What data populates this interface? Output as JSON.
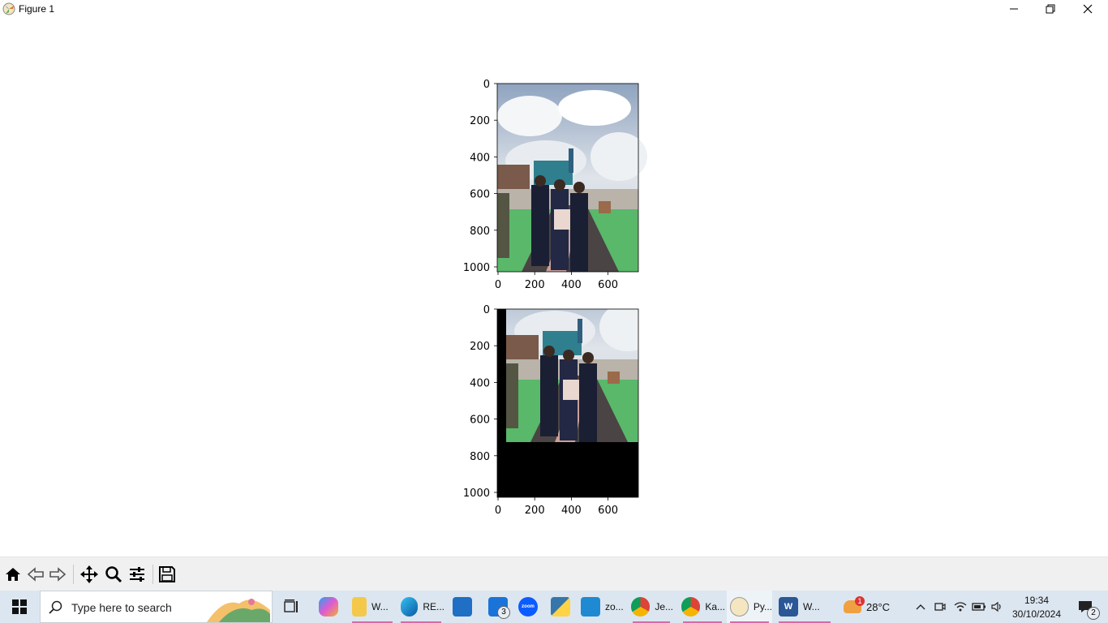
{
  "window": {
    "title": "Figure 1",
    "controls": {
      "minimize": "minimize",
      "maximize": "restore",
      "close": "close"
    }
  },
  "figure": {
    "subplots": [
      {
        "name": "original-image",
        "y_ticks": [
          "0",
          "200",
          "400",
          "600",
          "800",
          "1000"
        ],
        "x_ticks": [
          "0",
          "200",
          "400",
          "600"
        ]
      },
      {
        "name": "translated-image",
        "y_ticks": [
          "0",
          "200",
          "400",
          "600",
          "800",
          "1000"
        ],
        "x_ticks": [
          "0",
          "200",
          "400",
          "600"
        ]
      }
    ]
  },
  "toolbar": {
    "buttons": [
      "home-icon",
      "back-icon",
      "forward-icon",
      "pan-icon",
      "zoom-icon",
      "configure-subplots-icon",
      "save-icon"
    ]
  },
  "taskbar": {
    "search_placeholder": "Type here to search",
    "apps": [
      {
        "name": "task-view",
        "label": ""
      },
      {
        "name": "copilot",
        "label": ""
      },
      {
        "name": "file-explorer",
        "label": "W..."
      },
      {
        "name": "edge",
        "label": "RE..."
      },
      {
        "name": "store",
        "label": ""
      },
      {
        "name": "mail",
        "label": "",
        "badge": "3"
      },
      {
        "name": "zoom",
        "label": ""
      },
      {
        "name": "python-idle",
        "label": ""
      },
      {
        "name": "vscode",
        "label": "zo..."
      },
      {
        "name": "chrome-1",
        "label": "Je..."
      },
      {
        "name": "chrome-2",
        "label": "Ka..."
      },
      {
        "name": "pyfigure",
        "label": "Py..."
      },
      {
        "name": "word",
        "label": "W..."
      }
    ],
    "weather": {
      "temp": "28°C",
      "badge": "1"
    },
    "clock": {
      "time": "19:34",
      "date": "30/10/2024"
    },
    "notifications_count": "2"
  },
  "colors": {
    "taskbar": "#dce6f0",
    "toolbar": "#f0f0f0",
    "accent": "#d76ba6"
  }
}
